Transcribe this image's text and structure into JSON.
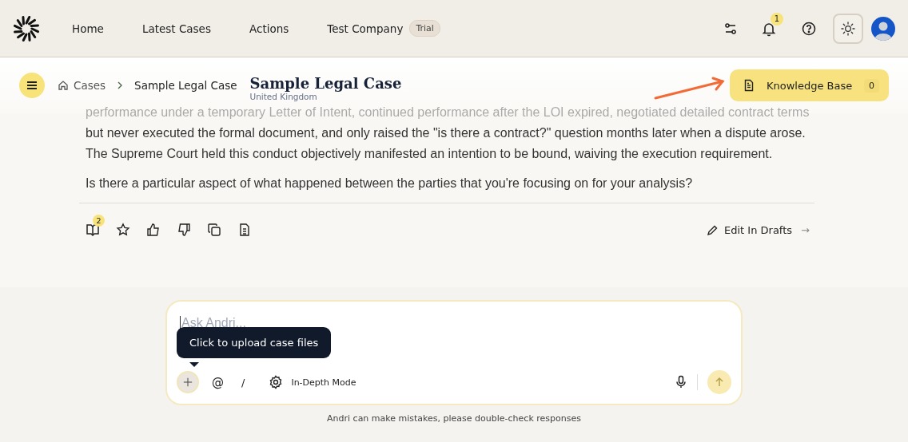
{
  "nav": {
    "items": [
      "Home",
      "Latest Cases",
      "Actions"
    ],
    "company": "Test Company",
    "company_badge": "Trial",
    "notifications_count": "1"
  },
  "breadcrumb": {
    "root": "Cases",
    "current": "Sample Legal Case"
  },
  "case": {
    "title": "Sample Legal Case",
    "jurisdiction": "United Kingdom"
  },
  "knowledge_base": {
    "label": "Knowledge Base",
    "count": "0"
  },
  "message": {
    "paragraphs": [
      {
        "text": "performance under a temporary Letter of Intent, continued performance after the LOI expired, negotiated detailed contract terms",
        "faded": true
      },
      {
        "text": "but never executed the formal document, and only raised the \"is there a contract?\" question months later when a dispute arose. The Supreme Court held this conduct objectively manifested an intention to be bound, waiving the execution requirement.",
        "faded": false
      },
      {
        "text": "Is there a particular aspect of what happened between the parties that you're focusing on for your analysis?",
        "faded": false
      }
    ],
    "sources_count": "2",
    "edit_label": "Edit In Drafts",
    "edit_arrow": "→"
  },
  "composer": {
    "placeholder": "Ask Andri...",
    "tooltip": "Click to upload case files",
    "mention": "@",
    "command": "/",
    "mode": "In-Depth Mode"
  },
  "disclaimer": "Andri can make mistakes, please double-check responses"
}
